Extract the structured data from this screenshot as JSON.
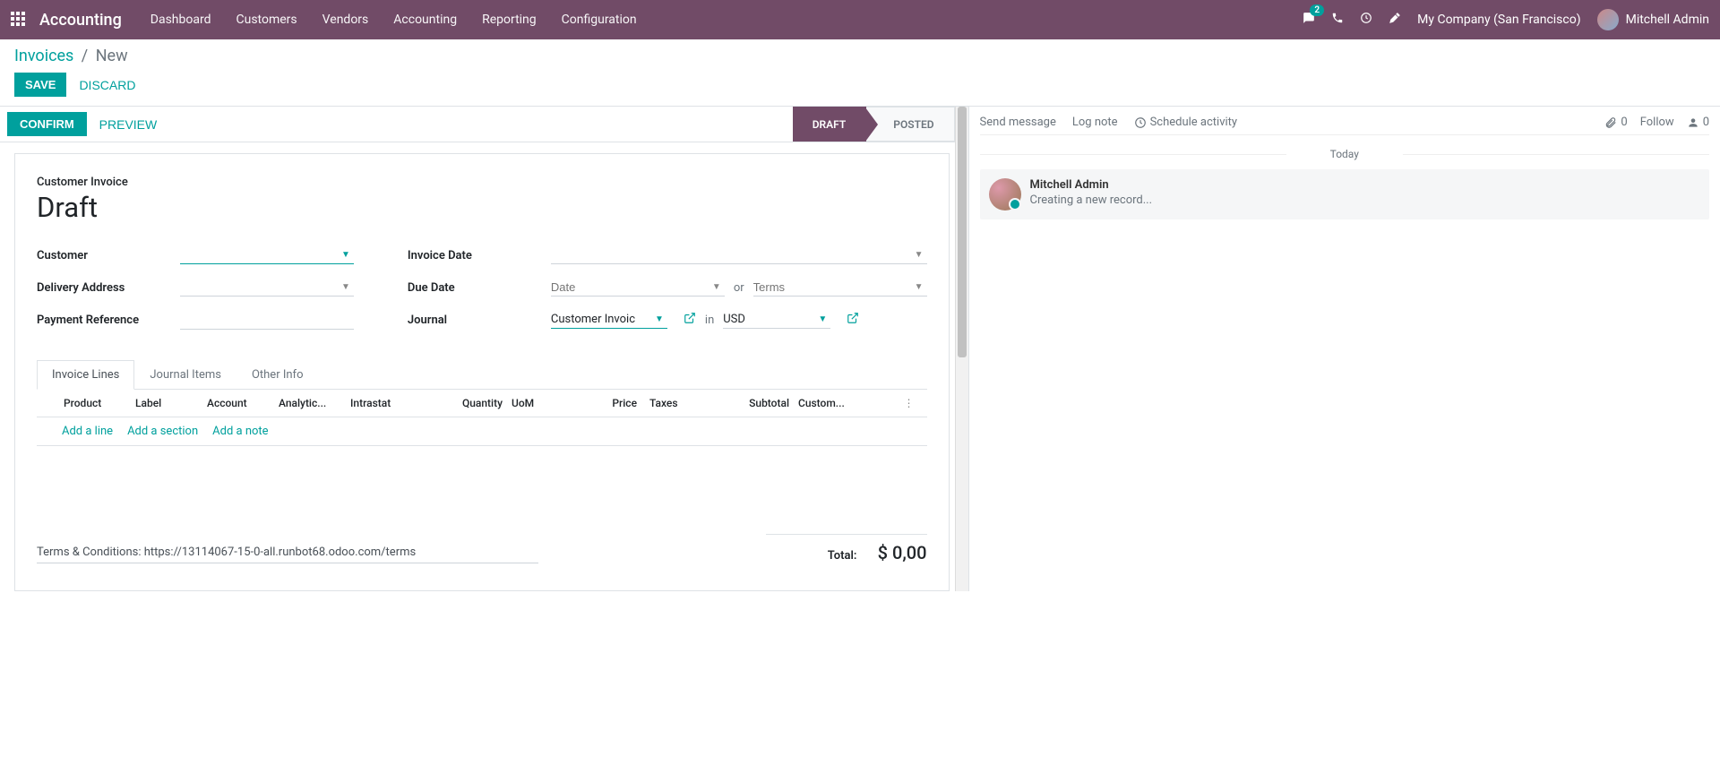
{
  "nav": {
    "brand": "Accounting",
    "links": [
      "Dashboard",
      "Customers",
      "Vendors",
      "Accounting",
      "Reporting",
      "Configuration"
    ],
    "messages_badge": "2",
    "company": "My Company (San Francisco)",
    "user": "Mitchell Admin"
  },
  "breadcrumb": {
    "root": "Invoices",
    "current": "New"
  },
  "buttons": {
    "save": "SAVE",
    "discard": "DISCARD",
    "confirm": "CONFIRM",
    "preview": "PREVIEW"
  },
  "stages": {
    "draft": "DRAFT",
    "posted": "POSTED"
  },
  "sheet": {
    "label": "Customer Invoice",
    "title": "Draft",
    "fields": {
      "customer": "Customer",
      "delivery_address": "Delivery Address",
      "payment_reference": "Payment Reference",
      "invoice_date": "Invoice Date",
      "due_date": "Due Date",
      "journal": "Journal",
      "date_placeholder": "Date",
      "terms_placeholder": "Terms",
      "or": "or",
      "in": "in",
      "journal_value": "Customer Invoic",
      "currency_value": "USD"
    }
  },
  "tabs": {
    "invoice_lines": "Invoice Lines",
    "journal_items": "Journal Items",
    "other_info": "Other Info"
  },
  "columns": {
    "product": "Product",
    "label": "Label",
    "account": "Account",
    "analytic": "Analytic...",
    "intrastat": "Intrastat",
    "quantity": "Quantity",
    "uom": "UoM",
    "price": "Price",
    "taxes": "Taxes",
    "subtotal": "Subtotal",
    "customs": "Custom..."
  },
  "line_actions": {
    "add_line": "Add a line",
    "add_section": "Add a section",
    "add_note": "Add a note"
  },
  "footer": {
    "terms": "Terms & Conditions: https://13114067-15-0-all.runbot68.odoo.com/terms",
    "total_label": "Total:",
    "total_value": "$ 0,00"
  },
  "chatter": {
    "send_message": "Send message",
    "log_note": "Log note",
    "schedule_activity": "Schedule activity",
    "attachments": "0",
    "follow": "Follow",
    "followers": "0",
    "today": "Today",
    "msg_author": "Mitchell Admin",
    "msg_text": "Creating a new record..."
  }
}
